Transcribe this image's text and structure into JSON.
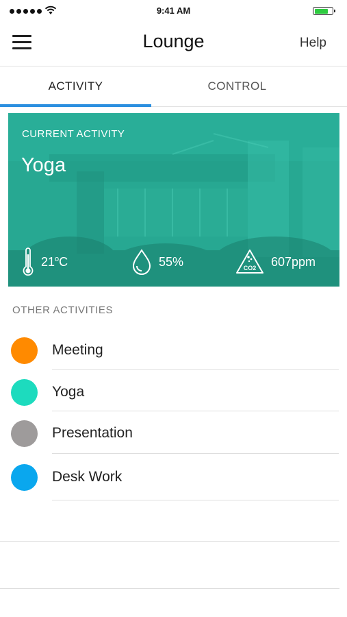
{
  "status_bar": {
    "time": "9:41 AM"
  },
  "header": {
    "title": "Lounge",
    "help_label": "Help"
  },
  "tabs": [
    {
      "label": "ACTIVITY",
      "active": true
    },
    {
      "label": "CONTROL",
      "active": false
    }
  ],
  "current_activity": {
    "label": "CURRENT ACTIVITY",
    "name": "Yoga",
    "temperature_value": "21",
    "temperature_unit_sup": "o",
    "temperature_unit": "C",
    "humidity": "55%",
    "co2": "607ppm",
    "co2_icon_text": "CO2",
    "card_color": "#26A893"
  },
  "other_activities": {
    "label": "OTHER ACTIVITIES",
    "items": [
      {
        "name": "Meeting",
        "color": "#FF8A00"
      },
      {
        "name": "Yoga",
        "color": "#1DDBBE"
      },
      {
        "name": "Presentation",
        "color": "#9E9B9B"
      },
      {
        "name": "Desk Work",
        "color": "#0AA7EE"
      }
    ]
  },
  "colors": {
    "accent": "#2B8FE0"
  }
}
